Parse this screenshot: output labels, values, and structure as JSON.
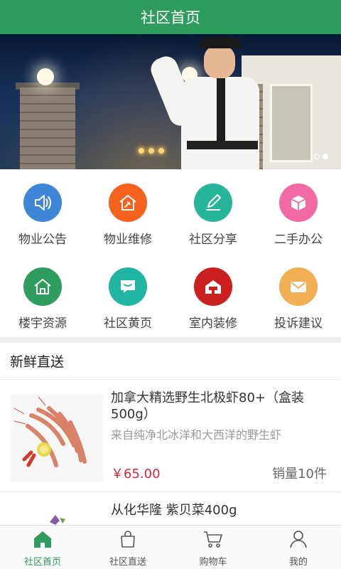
{
  "header": {
    "title": "社区首页"
  },
  "banner": {
    "slides": 2,
    "active_slide": 2
  },
  "services": [
    {
      "label": "物业公告",
      "icon": "speaker-icon",
      "color": "#3f86d6"
    },
    {
      "label": "物业维修",
      "icon": "house-repair-icon",
      "color": "#f4621e"
    },
    {
      "label": "社区分享",
      "icon": "edit-pencil-icon",
      "color": "#27b59a"
    },
    {
      "label": "二手办公",
      "icon": "box-icon",
      "color": "#f26aa3"
    },
    {
      "label": "楼宇资源",
      "icon": "home-icon",
      "color": "#2e9c5e"
    },
    {
      "label": "社区黄页",
      "icon": "chat-bubble-icon",
      "color": "#1fb5a0"
    },
    {
      "label": "室内装修",
      "icon": "house-decor-icon",
      "color": "#cc1f1f"
    },
    {
      "label": "投诉建议",
      "icon": "mail-icon",
      "color": "#f2ae52"
    }
  ],
  "section": {
    "title": "新鲜直送"
  },
  "products": [
    {
      "name": "加拿大精选野生北极虾80+（盒装500g）",
      "desc": "来自纯净北冰洋和大西洋的野生虾",
      "price": "￥65.00",
      "sales": "销量10件"
    },
    {
      "name": "从化华隆 紫贝菜400g",
      "desc": "",
      "price": "",
      "sales": ""
    }
  ],
  "tabs": [
    {
      "label": "社区首页",
      "icon": "home-icon",
      "active": true
    },
    {
      "label": "社区直送",
      "icon": "shopping-bag-icon",
      "active": false
    },
    {
      "label": "购物车",
      "icon": "cart-icon",
      "active": false
    },
    {
      "label": "我的",
      "icon": "user-icon",
      "active": false
    }
  ],
  "colors": {
    "primary": "#2e9c5e",
    "price": "#e0243a"
  }
}
